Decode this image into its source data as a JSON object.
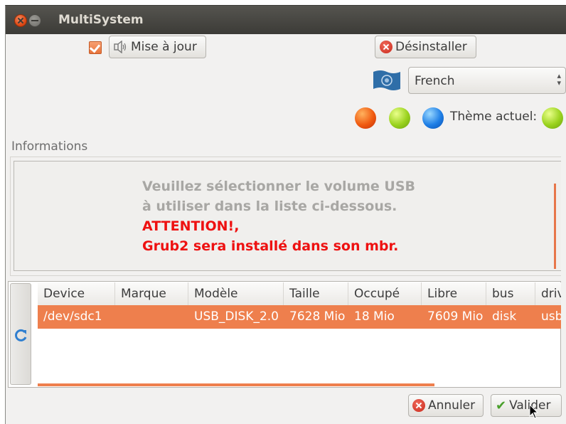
{
  "window": {
    "title": "MultiSystem"
  },
  "toolbar": {
    "update_checked": true,
    "update_label": "Mise à jour",
    "uninstall_label": "Désinstaller",
    "language": "French",
    "theme_label": "Thème actuel:"
  },
  "colors": {
    "accent": "#ee7f4d",
    "warning": "#ee1111",
    "theme_current": "#9ad21e"
  },
  "themes": [
    "orange-red",
    "green",
    "blue"
  ],
  "info": {
    "title": "Informations",
    "line1": "Veuillez sélectionner le volume USB",
    "line2": "à utiliser dans la liste ci-dessous.",
    "line3": "ATTENTION!,",
    "line4": "Grub2 sera installé dans son mbr."
  },
  "devices": {
    "columns": [
      "Device",
      "Marque",
      "Modèle",
      "Taille",
      "Occupé",
      "Libre",
      "bus",
      "driv"
    ],
    "rows": [
      [
        "/dev/sdc1",
        "",
        "USB_DISK_2.0",
        "7628 Mio",
        "18 Mio",
        "7609 Mio",
        "disk",
        "usb"
      ]
    ]
  },
  "footer": {
    "cancel_label": "Annuler",
    "validate_label": "Valider"
  },
  "icons": [
    "close-icon",
    "minimize-icon",
    "speaker-icon",
    "uninstall-icon",
    "flag-icon",
    "refresh-icon",
    "cancel-icon",
    "check-icon"
  ]
}
